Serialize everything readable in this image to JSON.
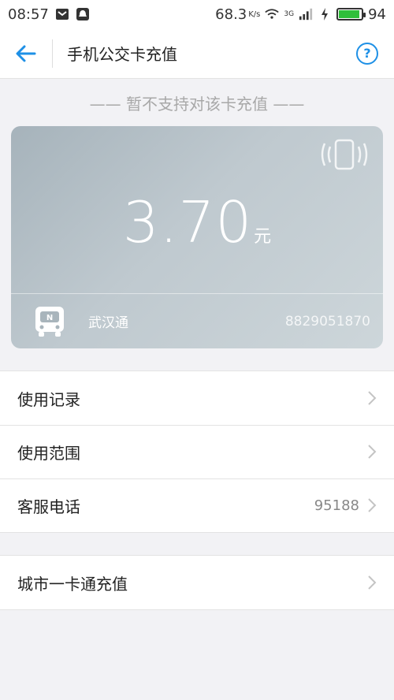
{
  "status_bar": {
    "time": "08:57",
    "speed": "68.3",
    "speed_unit": "K/s",
    "network": "3G",
    "battery": "94",
    "battery_level": 0.94
  },
  "header": {
    "title": "手机公交卡充值",
    "help_label": "?"
  },
  "notice": "—— 暂不支持对该卡充值 ——",
  "card": {
    "balance": "3.70",
    "unit": "元",
    "name": "武汉通",
    "number": "8829051870"
  },
  "menu": {
    "items": [
      {
        "label": "使用记录",
        "value": ""
      },
      {
        "label": "使用范围",
        "value": ""
      },
      {
        "label": "客服电话",
        "value": "95188"
      }
    ],
    "secondary": [
      {
        "label": "城市一卡通充值",
        "value": ""
      }
    ]
  },
  "colors": {
    "accent": "#1e90e6",
    "card_start": "#a6b3bb",
    "card_end": "#cdd6da",
    "background": "#f2f2f5"
  }
}
